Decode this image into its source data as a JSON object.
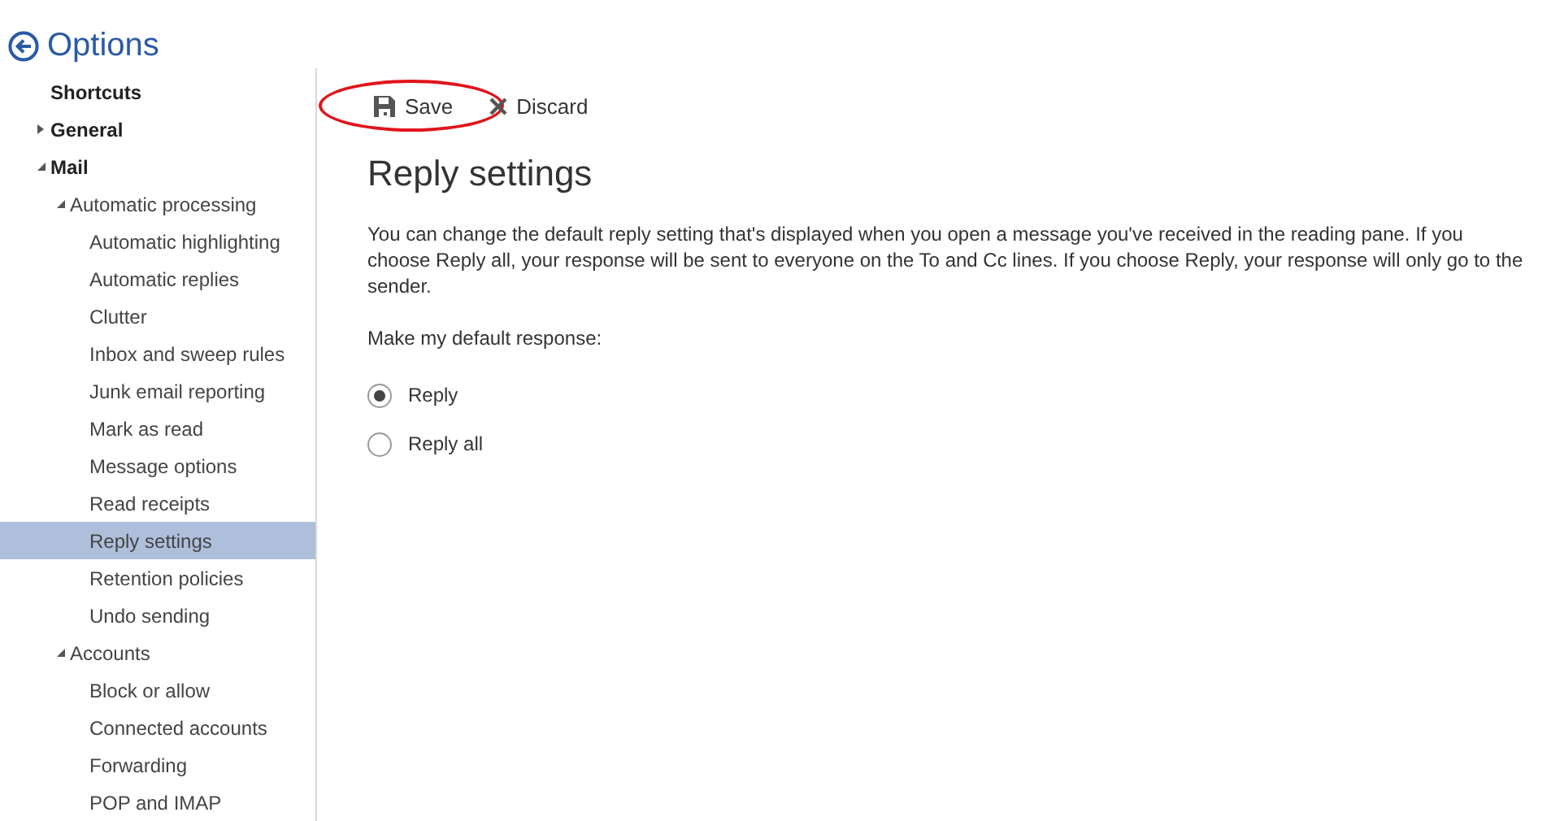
{
  "header": {
    "title": "Options"
  },
  "sidebar": {
    "items": [
      {
        "label": "Shortcuts",
        "selected": false
      },
      {
        "label": "General",
        "selected": false,
        "expanded": false
      },
      {
        "label": "Mail",
        "selected": false,
        "expanded": true,
        "children": [
          {
            "label": "Automatic processing",
            "selected": false,
            "expanded": true,
            "children": [
              {
                "label": "Automatic highlighting",
                "selected": false
              },
              {
                "label": "Automatic replies",
                "selected": false
              },
              {
                "label": "Clutter",
                "selected": false
              },
              {
                "label": "Inbox and sweep rules",
                "selected": false
              },
              {
                "label": "Junk email reporting",
                "selected": false
              },
              {
                "label": "Mark as read",
                "selected": false
              },
              {
                "label": "Message options",
                "selected": false
              },
              {
                "label": "Read receipts",
                "selected": false
              },
              {
                "label": "Reply settings",
                "selected": true
              },
              {
                "label": "Retention policies",
                "selected": false
              },
              {
                "label": "Undo sending",
                "selected": false
              }
            ]
          },
          {
            "label": "Accounts",
            "selected": false,
            "expanded": true,
            "children": [
              {
                "label": "Block or allow",
                "selected": false
              },
              {
                "label": "Connected accounts",
                "selected": false
              },
              {
                "label": "Forwarding",
                "selected": false
              },
              {
                "label": "POP and IMAP",
                "selected": false
              }
            ]
          }
        ]
      }
    ]
  },
  "toolbar": [
    {
      "kind": "save",
      "label": "Save",
      "circled": true
    },
    {
      "kind": "discard",
      "label": "Discard",
      "circled": false
    }
  ],
  "page": {
    "title": "Reply settings",
    "description": "You can change the default reply setting that's displayed when you open a message you've received in the reading pane. If you choose Reply all, your response will be sent to everyone on the To and Cc lines. If you choose Reply, your response will only go to the sender.",
    "prompt": "Make my default response:",
    "options": [
      {
        "label": "Reply",
        "selected": true
      },
      {
        "label": "Reply all",
        "selected": false
      }
    ]
  }
}
